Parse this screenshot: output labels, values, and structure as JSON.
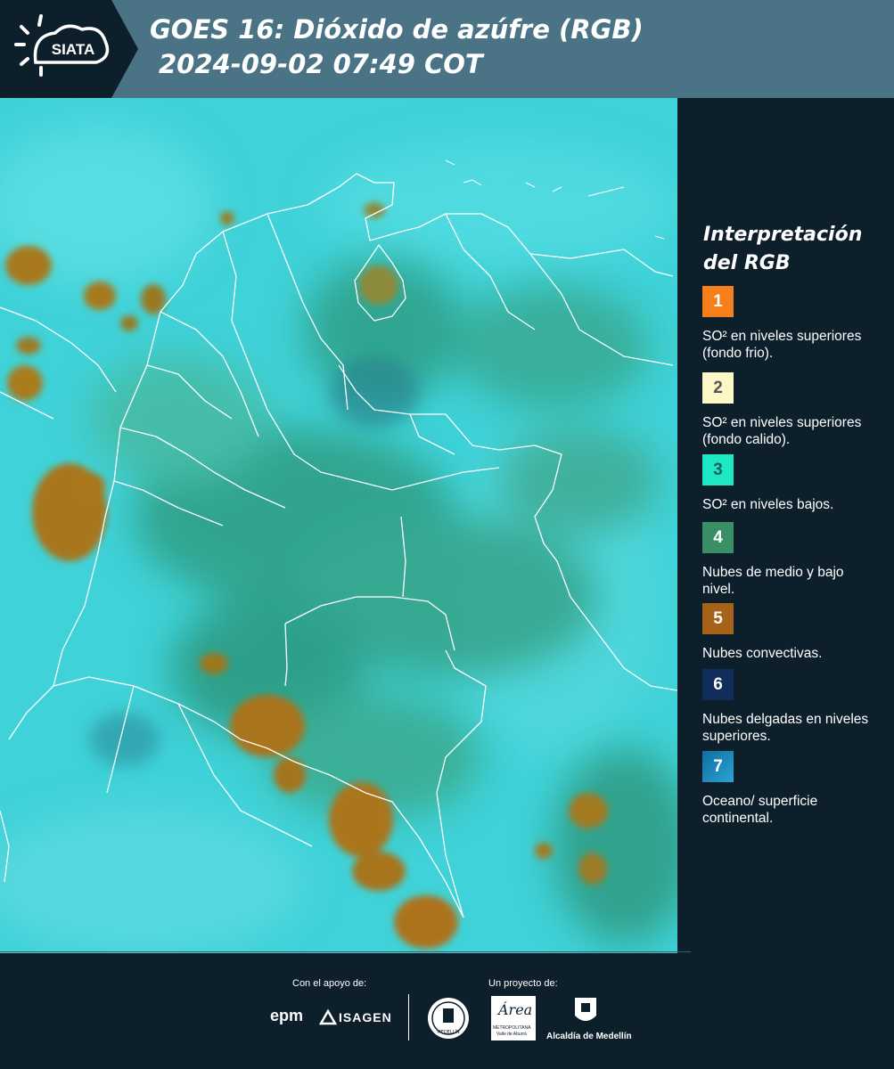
{
  "header": {
    "logo_text": "SIATA",
    "title_line1": "GOES 16: Dióxido de azúfre (RGB)",
    "title_line2": "2024-09-02 07:49 COT"
  },
  "legend": {
    "title_line1": "Interpretación",
    "title_line2": "del RGB",
    "items": [
      {
        "number": "1",
        "color": "#f77f1b",
        "number_color": "#ffffff",
        "text": "SO² en niveles superiores (fondo frio)."
      },
      {
        "number": "2",
        "color": "#fdf7c7",
        "number_color": "#555555",
        "text": "SO² en niveles superiores (fondo calido)."
      },
      {
        "number": "3",
        "color": "#1ee8c3",
        "number_color": "#1a5e5a",
        "text": "SO² en niveles bajos."
      },
      {
        "number": "4",
        "color": "#3a8f65",
        "number_color": "#ffffff",
        "text": "Nubes de medio y bajo nivel."
      },
      {
        "number": "5",
        "color": "#a7621a",
        "number_color": "#ffffff",
        "text": "Nubes convectivas."
      },
      {
        "number": "6",
        "color": "#112d5c",
        "number_color": "#ffffff",
        "text": "Nubes delgadas en niveles superiores."
      },
      {
        "number": "7",
        "color": "#1e8fbf",
        "number_color": "#ffffff",
        "text": "Oceano/ superficie continental."
      }
    ]
  },
  "footer": {
    "support_label": "Con el apoyo de:",
    "project_label": "Un proyecto de:",
    "epm_logo": "epm",
    "isagen_logo": "ISAGEN",
    "area_logo": "Área",
    "area_subtitle": "METROPOLITANA",
    "area_subtitle2": "Valle de Aburrá",
    "alcaldia_label": "Alcaldía de Medellín",
    "medellin_seal_text": "MEDELLÍN"
  }
}
